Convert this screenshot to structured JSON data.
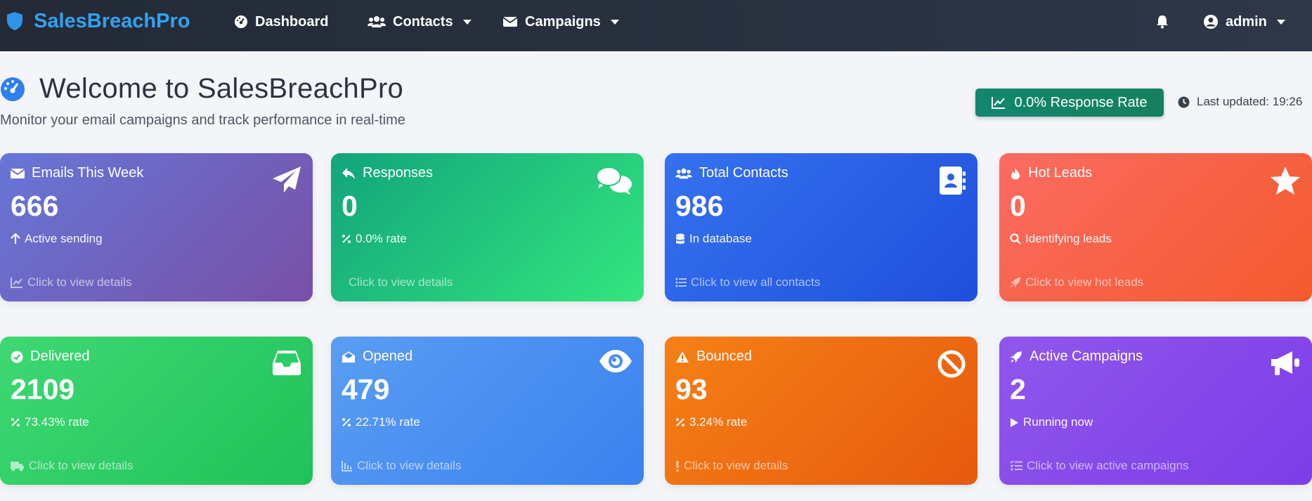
{
  "navbar": {
    "brand": "SalesBreachPro",
    "dashboard": "Dashboard",
    "contacts": "Contacts",
    "campaigns": "Campaigns",
    "user": "admin"
  },
  "header": {
    "title": "Welcome to SalesBreachPro",
    "subtitle": "Monitor your email campaigns and track performance in real-time",
    "response_rate_btn": "0.0% Response Rate",
    "last_updated": "Last updated: 19:26"
  },
  "cards": [
    {
      "title": "Emails This Week",
      "value": "666",
      "sub": "Active sending",
      "link": "Click to view details",
      "icon": "paper-plane-icon",
      "color": "#6f62c0"
    },
    {
      "title": "Responses",
      "value": "0",
      "sub": "0.0% rate",
      "link": "Click to view details",
      "icon": "comments-icon",
      "color": "#22c27c"
    },
    {
      "title": "Total Contacts",
      "value": "986",
      "sub": "In database",
      "link": "Click to view all contacts",
      "icon": "address-book-icon",
      "color": "#2a62e6"
    },
    {
      "title": "Hot Leads",
      "value": "0",
      "sub": "Identifying leads",
      "link": "Click to view hot leads",
      "icon": "star-icon",
      "color": "#f8623f"
    },
    {
      "title": "Delivered",
      "value": "2109",
      "sub": "73.43% rate",
      "link": "Click to view details",
      "icon": "inbox-icon",
      "color": "#2ccd67"
    },
    {
      "title": "Opened",
      "value": "479",
      "sub": "22.71% rate",
      "link": "Click to view details",
      "icon": "eye-icon",
      "color": "#4a90f1"
    },
    {
      "title": "Bounced",
      "value": "93",
      "sub": "3.24% rate",
      "link": "Click to view details",
      "icon": "ban-icon",
      "color": "#ee6d12"
    },
    {
      "title": "Active Campaigns",
      "value": "2",
      "sub": "Running now",
      "link": "Click to view active campaigns",
      "icon": "bullhorn-icon",
      "color": "#864aea"
    }
  ]
}
